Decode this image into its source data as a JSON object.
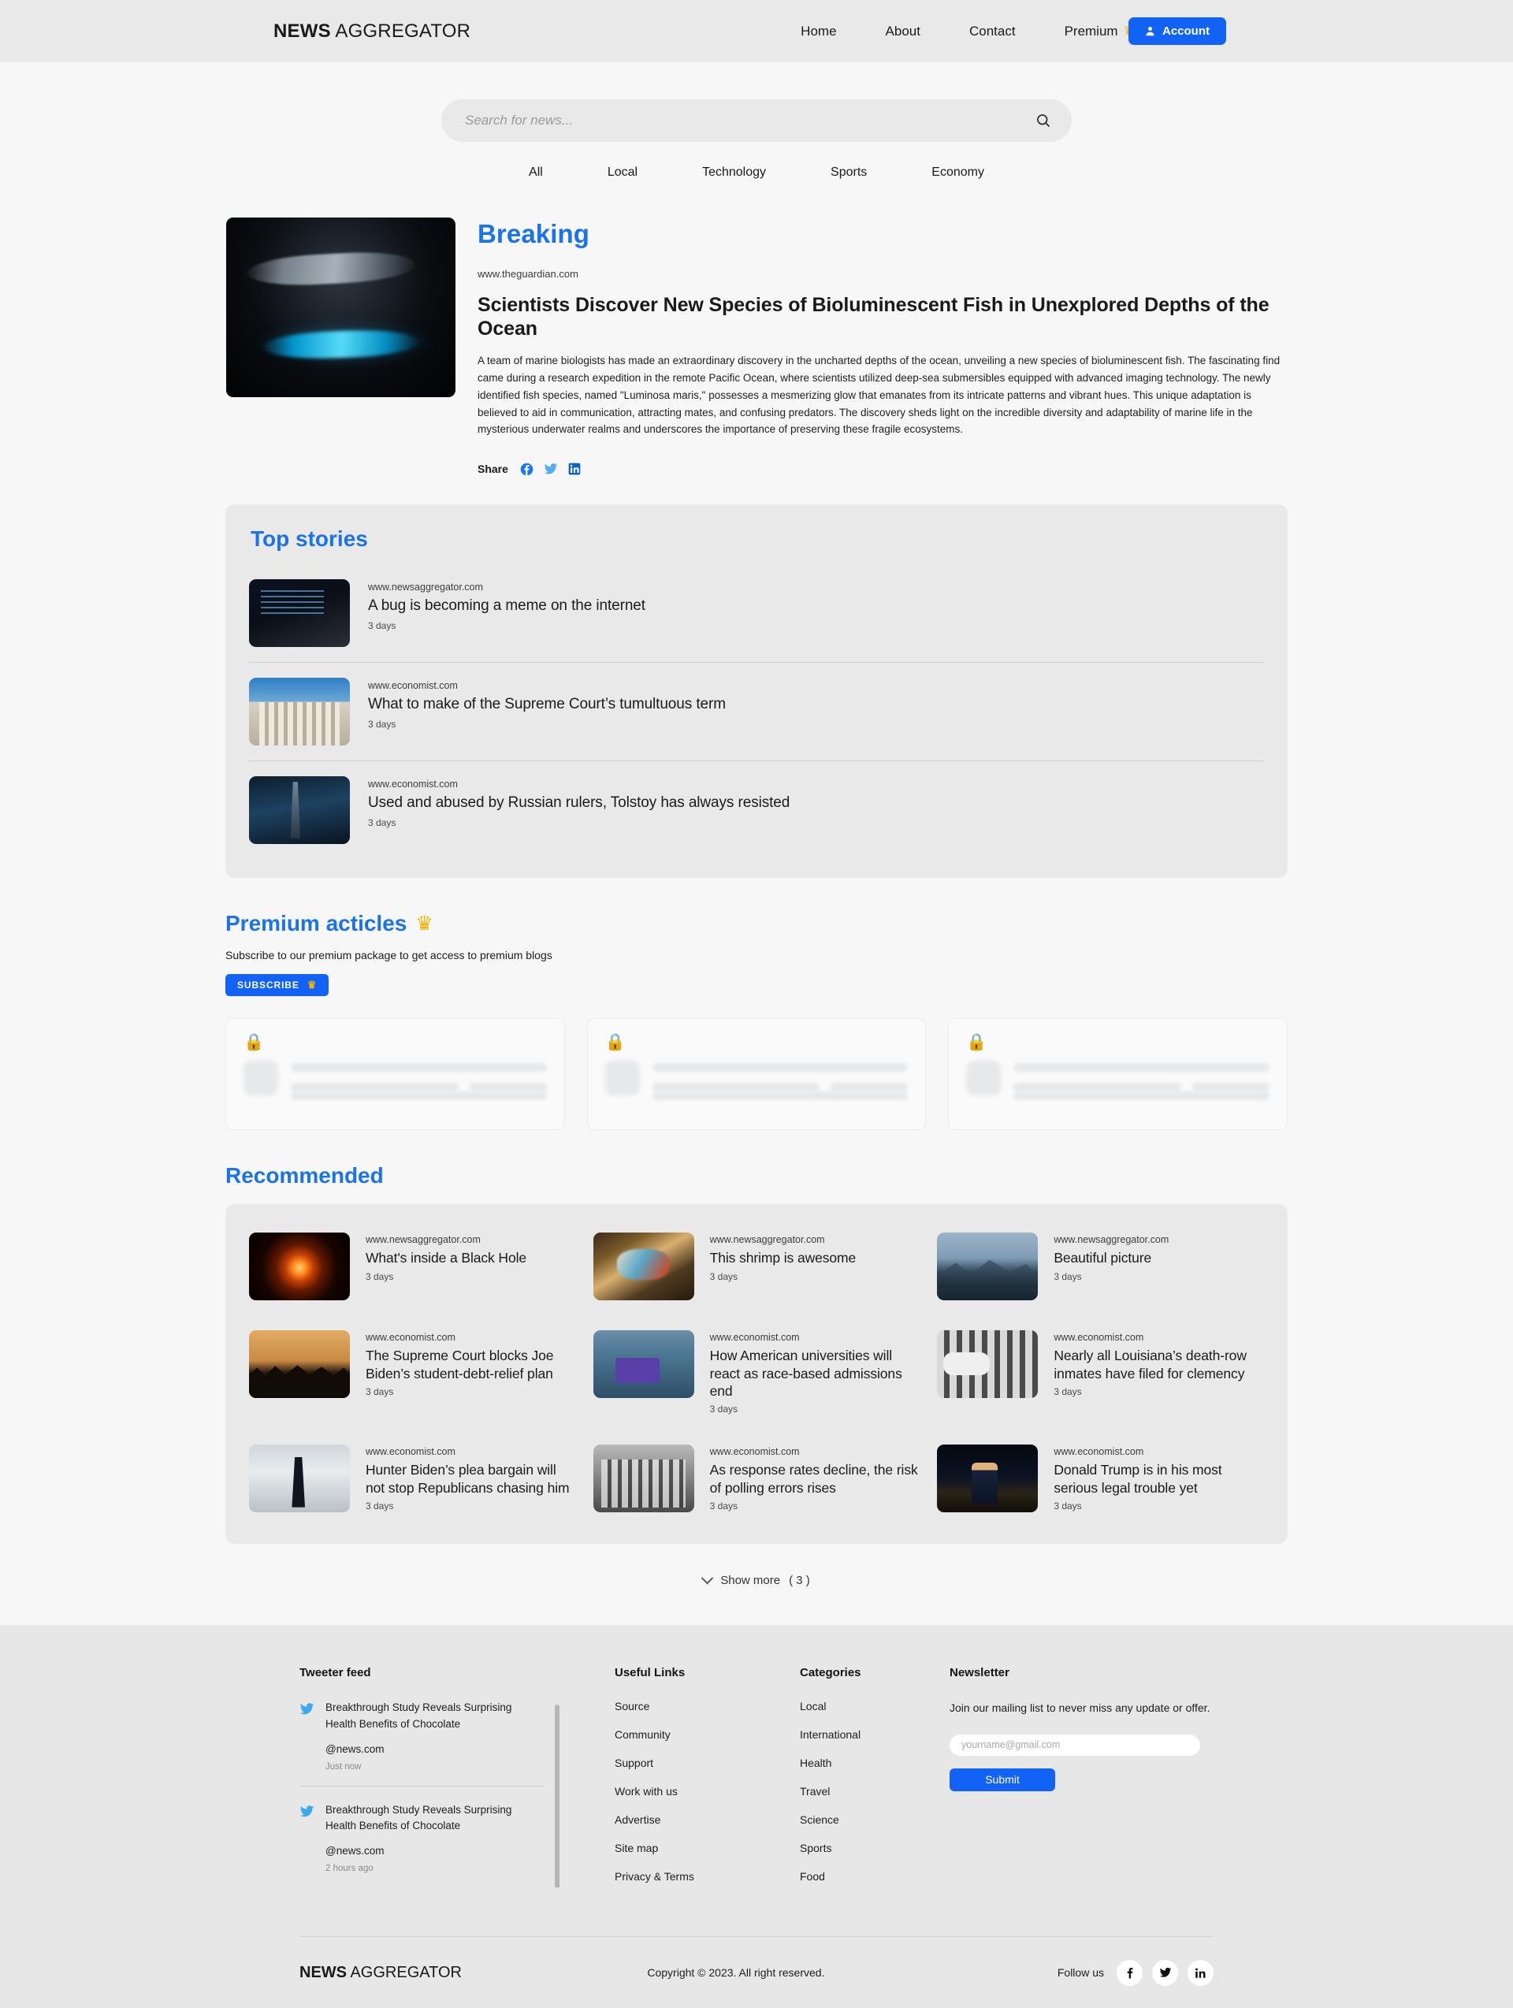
{
  "header": {
    "brand_bold": "NEWS",
    "brand_light": " AGGREGATOR",
    "nav": [
      {
        "label": "Home"
      },
      {
        "label": "About"
      },
      {
        "label": "Contact"
      },
      {
        "label": "Premium"
      }
    ],
    "premium_crown": "♛",
    "account_label": "Account"
  },
  "search": {
    "placeholder": "Search for news...",
    "value": "",
    "icon": "search-icon"
  },
  "categories": [
    {
      "label": "All"
    },
    {
      "label": "Local"
    },
    {
      "label": "Technology"
    },
    {
      "label": "Sports"
    },
    {
      "label": "Economy"
    }
  ],
  "breaking": {
    "section_title": "Breaking",
    "source": "www.theguardian.com",
    "headline": "Scientists Discover New Species of Bioluminescent Fish in Unexplored Depths of the Ocean",
    "summary": "A team of marine biologists has made an extraordinary discovery in the uncharted depths of the ocean, unveiling a new species of bioluminescent fish. The fascinating find came during a research expedition in the remote Pacific Ocean, where scientists utilized deep-sea submersibles equipped with advanced imaging technology. The newly identified fish species, named \"Luminosa maris,\" possesses a mesmerizing glow that emanates from its intricate patterns and vibrant hues. This unique adaptation is believed to aid in communication, attracting mates, and confusing predators. The discovery sheds light on the incredible diversity and adaptability of marine life in the mysterious underwater realms and underscores the importance of preserving these fragile ecosystems.",
    "share_label": "Share",
    "share_icons": [
      "facebook-icon",
      "twitter-icon",
      "linkedin-icon"
    ]
  },
  "top_stories": {
    "title": "Top stories",
    "items": [
      {
        "source": "www.newsaggregator.com",
        "headline": "A bug is becoming a meme on the internet",
        "time": "3 days",
        "thumb": "t-code"
      },
      {
        "source": "www.economist.com",
        "headline": "What to make of the Supreme Court’s tumultuous term",
        "time": "3 days",
        "thumb": "t-court"
      },
      {
        "source": "www.economist.com",
        "headline": "Used and abused by Russian rulers, Tolstoy has always resisted",
        "time": "3 days",
        "thumb": "t-statue"
      }
    ]
  },
  "premium": {
    "title": "Premium acticles",
    "crown": "♛",
    "subtitle": "Subscribe to our premium package to get access to premium blogs",
    "subscribe_label": "SUBSCRIBE",
    "subscribe_crown": "♛",
    "locked_cards": 3,
    "lock_icon": "🔒"
  },
  "recommended": {
    "title": "Recommended",
    "items": [
      {
        "source": "www.newsaggregator.com",
        "headline": "What's inside a Black Hole",
        "time": "3 days",
        "thumb": "t-blackhole"
      },
      {
        "source": "www.newsaggregator.com",
        "headline": "This shrimp is awesome",
        "time": "3 days",
        "thumb": "t-shrimp"
      },
      {
        "source": "www.newsaggregator.com",
        "headline": "Beautiful picture",
        "time": "3 days",
        "thumb": "t-mountain"
      },
      {
        "source": "www.economist.com",
        "headline": "The Supreme Court blocks Joe Biden’s student-debt-relief plan",
        "time": "3 days",
        "thumb": "t-grads"
      },
      {
        "source": "www.economist.com",
        "headline": "How American universities will react as race-based admissions end",
        "time": "3 days",
        "thumb": "t-protest"
      },
      {
        "source": "www.economist.com",
        "headline": "Nearly all Louisiana’s death-row inmates have filed for clemency",
        "time": "3 days",
        "thumb": "t-bars"
      },
      {
        "source": "www.economist.com",
        "headline": "Hunter Biden’s plea bargain will not stop Republicans chasing him",
        "time": "3 days",
        "thumb": "t-plane"
      },
      {
        "source": "www.economist.com",
        "headline": "As response rates decline, the risk of polling errors rises",
        "time": "3 days",
        "thumb": "t-group"
      },
      {
        "source": "www.economist.com",
        "headline": "Donald Trump is in his most serious legal trouble yet",
        "time": "3 days",
        "thumb": "t-trump"
      }
    ],
    "show_more_label": "Show more",
    "show_more_count": "( 3 )"
  },
  "footer": {
    "tweeter": {
      "title": "Tweeter feed",
      "tweets": [
        {
          "text": "Breakthrough Study Reveals Surprising Health Benefits of Chocolate",
          "handle": "@news.com",
          "time": "Just now"
        },
        {
          "text": "Breakthrough Study Reveals Surprising Health Benefits of Chocolate",
          "handle": "@news.com",
          "time": "2 hours ago"
        }
      ]
    },
    "useful_links": {
      "title": "Useful Links",
      "items": [
        {
          "label": "Source"
        },
        {
          "label": "Community"
        },
        {
          "label": "Support"
        },
        {
          "label": "Work with us"
        },
        {
          "label": "Advertise"
        },
        {
          "label": "Site map"
        },
        {
          "label": "Privacy & Terms"
        }
      ]
    },
    "categories": {
      "title": "Categories",
      "items": [
        {
          "label": "Local"
        },
        {
          "label": "International"
        },
        {
          "label": "Health"
        },
        {
          "label": "Travel"
        },
        {
          "label": "Science"
        },
        {
          "label": "Sports"
        },
        {
          "label": "Food"
        }
      ]
    },
    "newsletter": {
      "title": "Newsletter",
      "description": "Join our mailing list to never miss any update or offer.",
      "placeholder": "yourname@gmail.com",
      "value": "",
      "submit_label": "Submit"
    },
    "bottom": {
      "brand_bold": "NEWS",
      "brand_light": " AGGREGATOR",
      "copyright": "Copyright © 2023. All right reserved.",
      "follow_label": "Follow us",
      "social": [
        "facebook-icon",
        "twitter-icon",
        "linkedin-icon"
      ]
    }
  },
  "colors": {
    "accent": "#1a73e8",
    "button": "#1263f5",
    "panel": "#e9e9e9",
    "page": "#f7f7f7",
    "crown": "#f5b301"
  }
}
